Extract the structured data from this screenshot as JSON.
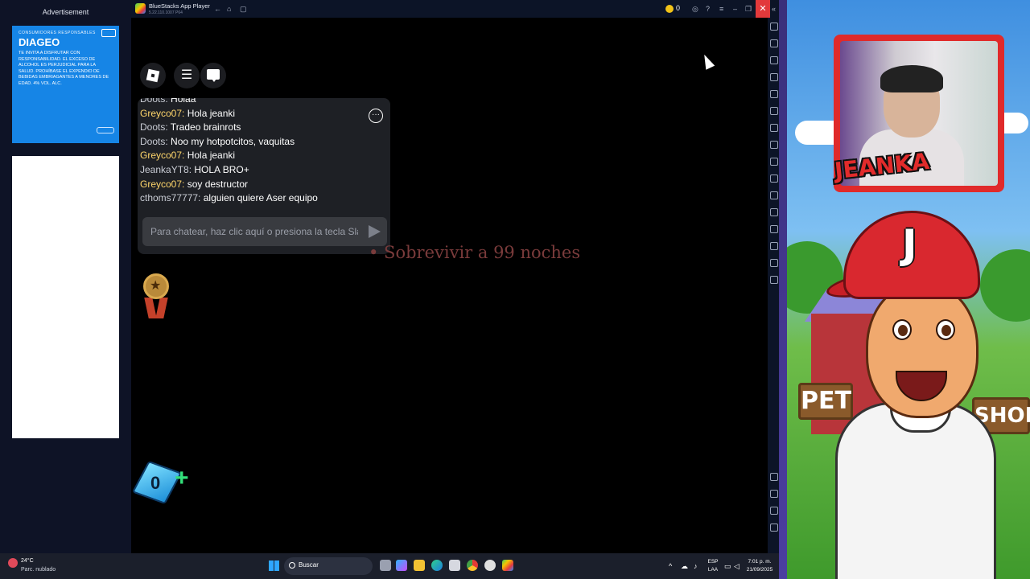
{
  "ad": {
    "header": "Advertisement",
    "brand_small": "CONSUMIDORES RESPONSABLES",
    "brand": "DIAGEO",
    "legal": "TE INVITA A DISFRUTAR CON RESPONSABILIDAD. EL EXCESO DE ALCOHOL ES PERJUDICIAL PARA LA SALUD. PROHÍBASE EL EXPENDIO DE BEBIDAS EMBRIAGANTES A MENORES DE EDAD. 4% VOL. ALC."
  },
  "bluestacks": {
    "title": "BlueStacks App Player",
    "version": "5.22.110.1007  P64",
    "coins": "0",
    "close_glyph": "✕"
  },
  "game": {
    "chat_messages": [
      {
        "user": "Doots:",
        "text": " Holaa",
        "user_style": "gray"
      },
      {
        "user": "Greyco07:",
        "text": " Hola jeanki",
        "user_style": "gold"
      },
      {
        "user": "Doots:",
        "text": " Tradeo brainrots",
        "user_style": "gray"
      },
      {
        "user": "Doots:",
        "text": " Noo my hotpotcitos, vaquitas",
        "user_style": "gray"
      },
      {
        "user": "Greyco07:",
        "text": " Hola jeanki",
        "user_style": "gold"
      },
      {
        "user": "JeankaYT8:",
        "text": " HOLA BRO+",
        "user_style": "gray"
      },
      {
        "user": "Greyco07:",
        "text": " soy destructor",
        "user_style": "gold"
      },
      {
        "user": "cthoms77777:",
        "text": " alguien quiere Aser equipo",
        "user_style": "gray"
      }
    ],
    "chat_placeholder": "Para chatear, haz clic aquí o presiona la tecla Slash.",
    "objective": "• Sobrevivir a 99 noches",
    "currency_value": "0",
    "currency_plus": "+"
  },
  "overlay": {
    "streamer_name": "JEANKA",
    "cap_letter": "J",
    "sign_left": "PET",
    "sign_right": "SHOP"
  },
  "taskbar": {
    "temperature": "24°C",
    "weather": "Parc. nublado",
    "search_label": "Buscar",
    "lang_top": "ESP",
    "lang_bottom": "LAA",
    "time": "7:01 p. m.",
    "date": "21/09/2025"
  }
}
